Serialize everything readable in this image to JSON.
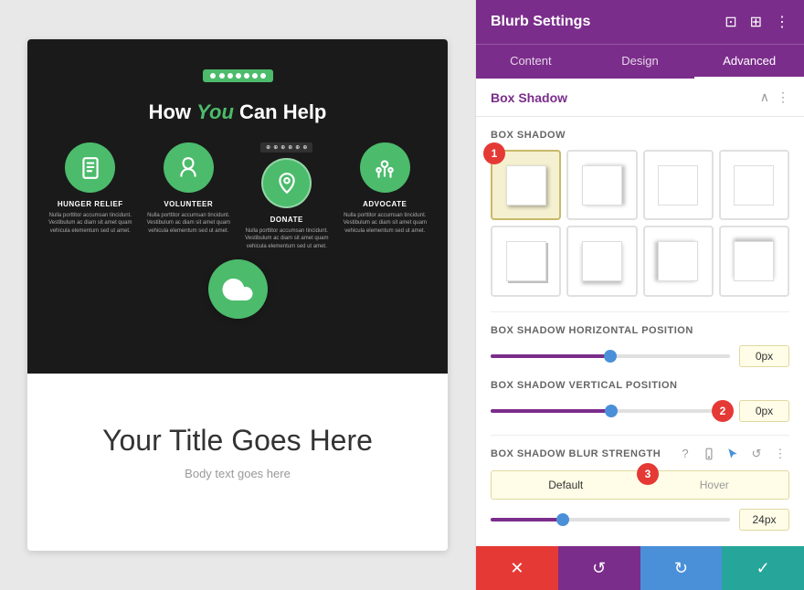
{
  "panel": {
    "title": "Blurb Settings",
    "tabs": [
      {
        "id": "content",
        "label": "Content"
      },
      {
        "id": "design",
        "label": "Design"
      },
      {
        "id": "advanced",
        "label": "Advanced",
        "active": true
      }
    ],
    "header_icons": [
      "⊡",
      "⊞",
      "⋮"
    ]
  },
  "box_shadow_section": {
    "title": "Box Shadow",
    "field_label": "Box Shadow",
    "options": [
      {
        "id": "all",
        "selected": true,
        "style": "all"
      },
      {
        "id": "right",
        "selected": false,
        "style": "right"
      },
      {
        "id": "none1",
        "selected": false,
        "style": "none"
      },
      {
        "id": "none2",
        "selected": false,
        "style": "none"
      },
      {
        "id": "bottom-right",
        "selected": false,
        "style": "bottom-right"
      },
      {
        "id": "bottom",
        "selected": false,
        "style": "bottom"
      },
      {
        "id": "left",
        "selected": false,
        "style": "left"
      },
      {
        "id": "top",
        "selected": false,
        "style": "top"
      }
    ]
  },
  "horizontal_position": {
    "label": "Box Shadow Horizontal Position",
    "value": "0px",
    "percent": 50
  },
  "vertical_position": {
    "label": "Box Shadow Vertical Position",
    "value": "0px",
    "percent": 50
  },
  "blur_strength": {
    "label": "Box Shadow Blur Strength",
    "default_tab": "Default",
    "hover_tab": "Hover",
    "value": "24px",
    "percent": 30
  },
  "badges": {
    "one": "1",
    "two": "2",
    "three": "3"
  },
  "actions": {
    "cancel": "✕",
    "reset": "↺",
    "refresh": "↻",
    "confirm": "✓"
  },
  "preview": {
    "title_part1": "How ",
    "title_highlight": "You",
    "title_part2": " Can Help",
    "blurbs": [
      {
        "label": "HUNGER RELIEF",
        "text": "Nulla porttitor accumsan tincidunt. Vestibulum ac diam sit amet quam vehicula elementum sed ut amet."
      },
      {
        "label": "VOLUNTEER",
        "text": "Nulla porttitor accumsan tincidunt. Vestibulum ac diam sit amet quam vehicula elementum sed ut amet."
      },
      {
        "label": "DONATE",
        "text": "Nulla porttitor accumsan tincidunt. Vestibulum ac diam sit amet quam vehicula elementum sed ut amet."
      },
      {
        "label": "ADVOCATE",
        "text": "Nulla porttitor accumsan tincidunt. Vestibulum ac diam sit amet quam vehicula elementum sed ut amet."
      }
    ],
    "main_title": "Your Title Goes Here",
    "body_text": "Body text goes here"
  }
}
